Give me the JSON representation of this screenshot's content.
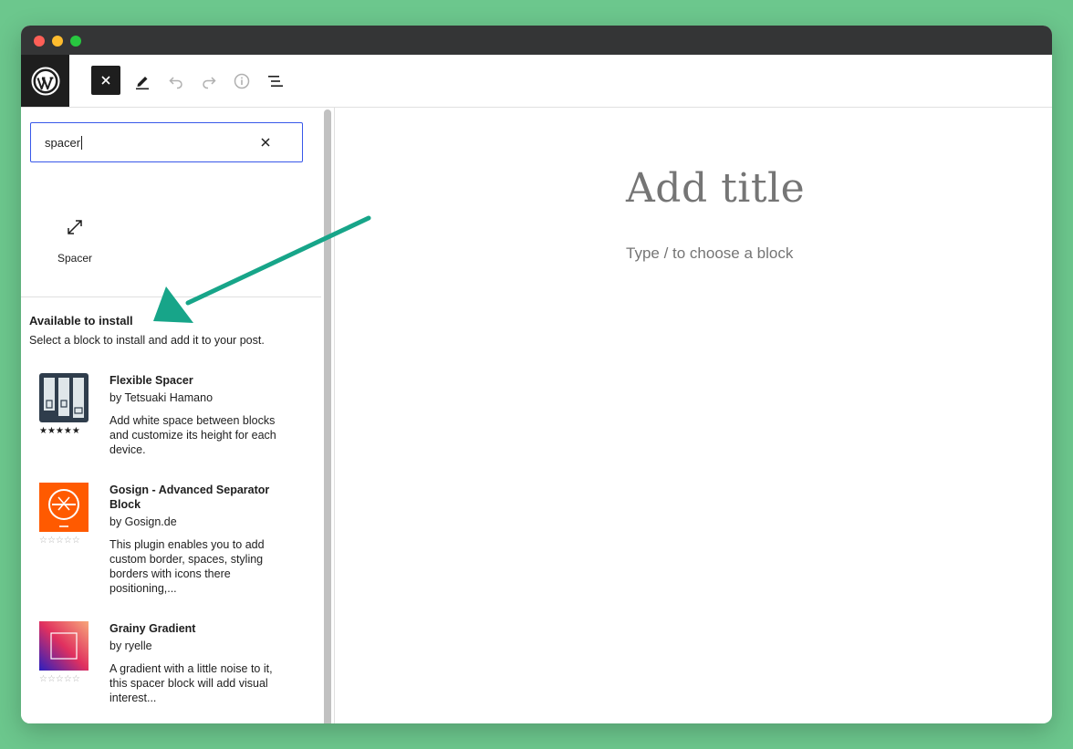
{
  "window": {
    "traffic_lights": [
      "close",
      "minimize",
      "maximize"
    ]
  },
  "toolbar": {
    "logo_icon": "wordpress-logo-icon",
    "close_icon": "close-icon",
    "tools_icon": "pen-icon",
    "undo_icon": "undo-icon",
    "redo_icon": "redo-icon",
    "info_icon": "info-icon",
    "list_view_icon": "list-view-icon"
  },
  "inserter": {
    "search": {
      "value": "spacer",
      "clear_icon": "close-icon"
    },
    "block_result": {
      "label": "Spacer",
      "icon": "resize-corner-icon"
    },
    "install": {
      "title": "Available to install",
      "description": "Select a block to install and add it to your post.",
      "plugins": [
        {
          "name": "Flexible Spacer",
          "author": "by Tetsuaki Hamano",
          "description_lines": [
            "Add white space between blocks",
            "and customize its height for each",
            "device."
          ],
          "rating": "★★★★★",
          "rating_value": 5
        },
        {
          "name_lines": [
            "Gosign - Advanced Separator",
            "Block"
          ],
          "author": "by Gosign.de",
          "description_lines": [
            "This plugin enables you to add",
            "custom border, spaces, styling",
            "borders with icons there",
            "positioning,..."
          ],
          "rating": "☆☆☆☆☆",
          "rating_value": 0
        },
        {
          "name": "Grainy Gradient",
          "author": "by ryelle",
          "description_lines": [
            "A gradient with a little noise to it,",
            "this spacer block will add visual",
            "interest..."
          ],
          "rating": "☆☆☆☆☆",
          "rating_value": 0
        }
      ]
    }
  },
  "canvas": {
    "title_placeholder": "Add title",
    "block_hint": "Type / to choose a block"
  },
  "colors": {
    "accent": "#3858e9",
    "arrow": "#17a589",
    "background": "#6cc78d"
  }
}
